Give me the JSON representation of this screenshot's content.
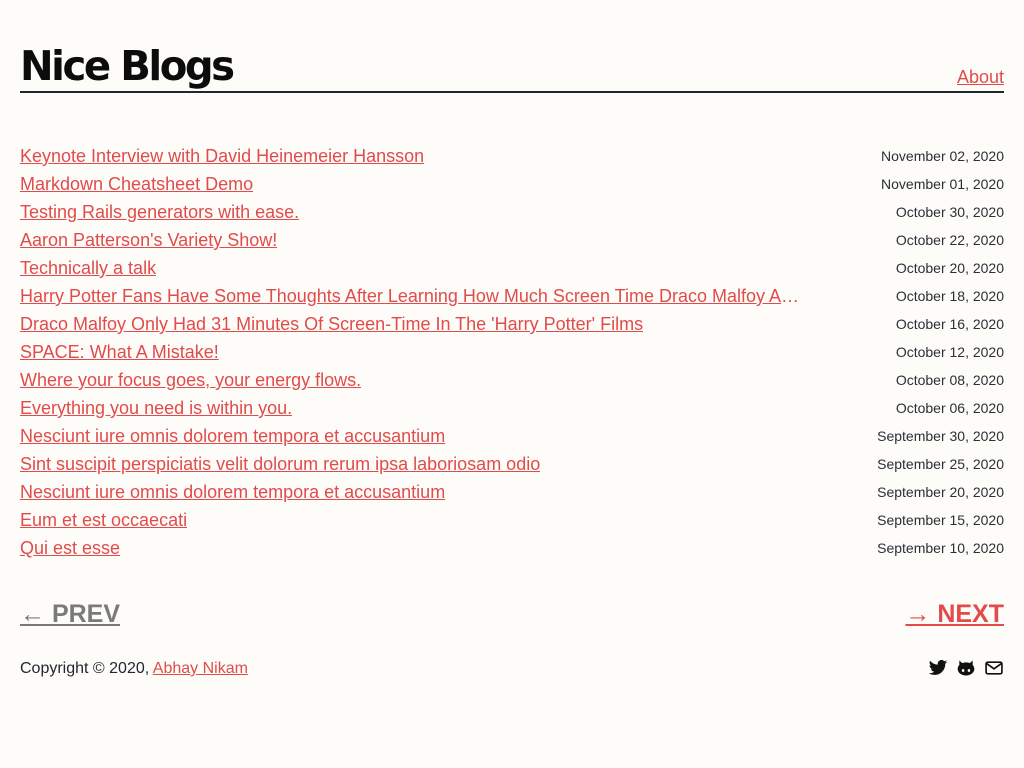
{
  "header": {
    "title": "Nice Blogs",
    "nav": {
      "about": "About"
    }
  },
  "posts": [
    {
      "title": "Keynote Interview with David Heinemeier Hansson",
      "date": "November 02, 2020"
    },
    {
      "title": "Markdown Cheatsheet Demo",
      "date": "November 01, 2020"
    },
    {
      "title": "Testing Rails generators with ease.",
      "date": "October 30, 2020"
    },
    {
      "title": "Aaron Patterson's Variety Show!",
      "date": "October 22, 2020"
    },
    {
      "title": "Technically a talk",
      "date": "October 20, 2020"
    },
    {
      "title": "Harry Potter Fans Have Some Thoughts After Learning How Much Screen Time Draco Malfoy Actually Had In The Films",
      "date": "October 18, 2020"
    },
    {
      "title": "Draco Malfoy Only Had 31 Minutes Of Screen-Time In The 'Harry Potter' Films",
      "date": "October 16, 2020"
    },
    {
      "title": "SPACE: What A Mistake!",
      "date": "October 12, 2020"
    },
    {
      "title": "Where your focus goes, your energy flows.",
      "date": "October 08, 2020"
    },
    {
      "title": "Everything you need is within you.",
      "date": "October 06, 2020"
    },
    {
      "title": "Nesciunt iure omnis dolorem tempora et accusantium",
      "date": "September 30, 2020"
    },
    {
      "title": "Sint suscipit perspiciatis velit dolorum rerum ipsa laboriosam odio",
      "date": "September 25, 2020"
    },
    {
      "title": "Nesciunt iure omnis dolorem tempora et accusantium",
      "date": "September 20, 2020"
    },
    {
      "title": "Eum et est occaecati",
      "date": "September 15, 2020"
    },
    {
      "title": "Qui est esse",
      "date": "September 10, 2020"
    }
  ],
  "pagination": {
    "prev_label": "← PREV",
    "next_label": "→ NEXT"
  },
  "footer": {
    "copyright": "Copyright © 2020,",
    "author": "Abhay Nikam",
    "social_icons": [
      "twitter-icon",
      "github-icon",
      "mail-icon"
    ]
  },
  "colors": {
    "background": "#fdfcf9",
    "accent": "#e14b4b",
    "text": "#22262e",
    "muted": "#7a7a7a"
  }
}
